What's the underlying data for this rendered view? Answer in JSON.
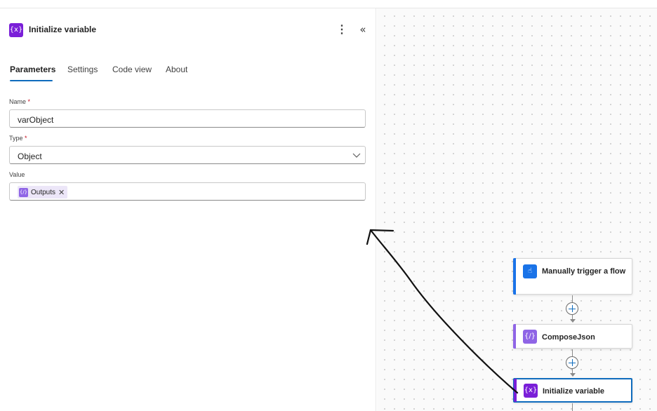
{
  "panel": {
    "title": "Initialize variable",
    "icon": "variable-icon",
    "tabs": [
      {
        "label": "Parameters",
        "active": true
      },
      {
        "label": "Settings",
        "active": false
      },
      {
        "label": "Code view",
        "active": false
      },
      {
        "label": "About",
        "active": false
      }
    ],
    "fields": {
      "name": {
        "label": "Name",
        "required_mark": "*",
        "value": "varObject"
      },
      "type": {
        "label": "Type",
        "required_mark": "*",
        "value": "Object"
      },
      "value": {
        "label": "Value",
        "token": {
          "label": "Outputs",
          "icon": "compose-icon",
          "remove": "✕"
        }
      }
    }
  },
  "flow": {
    "nodes": [
      {
        "label": "Manually trigger a flow",
        "icon": "manual-trigger-icon",
        "color": "#1a73e8"
      },
      {
        "label": "ComposeJson",
        "icon": "compose-icon",
        "color": "#8f65e6"
      },
      {
        "label": "Initialize variable",
        "icon": "variable-icon",
        "color": "#7a1fd8",
        "selected": true
      }
    ]
  },
  "colors": {
    "accent_blue": "#0f6cbd",
    "variable_purple": "#7a1fd8",
    "compose_purple": "#8f65e6",
    "trigger_blue": "#1a73e8",
    "required_red": "#c50f1f"
  }
}
